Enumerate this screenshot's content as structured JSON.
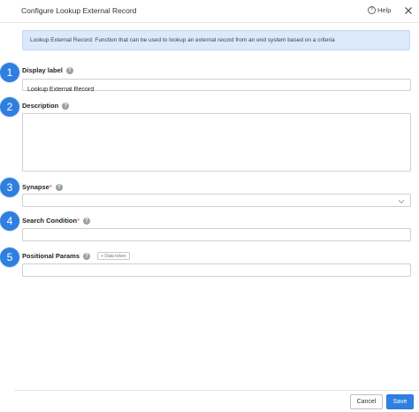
{
  "dialog": {
    "title": "Configure Lookup External Record",
    "help_label": "Help"
  },
  "info_banner": "Lookup External Record: Function that can be used to lookup an external record from an end system based on a criteria",
  "steps": [
    "1",
    "2",
    "3",
    "4",
    "5"
  ],
  "fields": {
    "display_label": {
      "label": "Display label",
      "value": "Lookup External Record"
    },
    "description": {
      "label": "Description",
      "value": ""
    },
    "synapse": {
      "label": "Synapse",
      "required_mark": "*",
      "value": ""
    },
    "search_condition": {
      "label": "Search Condition",
      "required_mark": "*",
      "value": ""
    },
    "positional_params": {
      "label": "Positional Params",
      "token_button": "+ Data token",
      "value": ""
    }
  },
  "footer": {
    "cancel_label": "Cancel",
    "save_label": "Save"
  },
  "colors": {
    "accent": "#2f7fe0",
    "info_background": "#dbe9fb",
    "required": "#dd3333"
  },
  "icons": {
    "help": "question-circle-icon",
    "close": "close-icon",
    "field_help": "question-mark-icon",
    "dropdown": "chevron-down-icon"
  }
}
